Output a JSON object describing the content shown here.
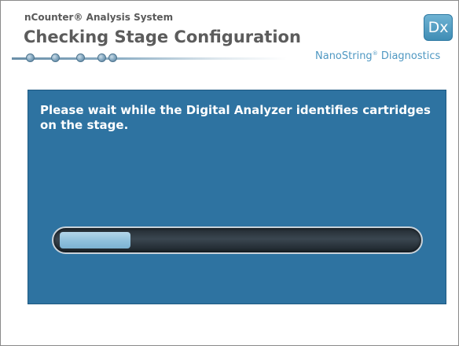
{
  "header": {
    "subtitle": "nCounter® Analysis System",
    "title": "Checking Stage Configuration",
    "steps_total": 5
  },
  "brand": {
    "badge": "Dx",
    "name": "NanoString",
    "registered": "®",
    "suffix": " Diagnostics"
  },
  "panel": {
    "message": "Please wait while the Digital Analyzer identifies cartridges on the stage."
  },
  "progress": {
    "fraction": 0.2
  },
  "colors": {
    "panel_background": "#2e73a1",
    "brand_text": "#4f98c2",
    "progress_fill": "#8fc0dc"
  }
}
